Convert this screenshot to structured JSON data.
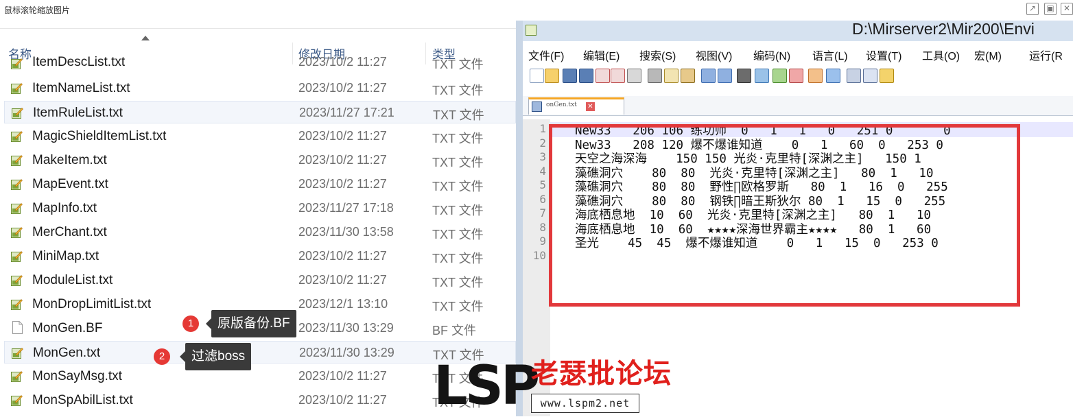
{
  "page_title": "鼠标滚轮缩放图片",
  "window_controls": [
    "expand-icon",
    "maximize-icon",
    "close-icon"
  ],
  "explorer": {
    "columns": {
      "name": "名称",
      "date": "修改日期",
      "type": "类型"
    },
    "partial_row": {
      "name": "ItemDescList.txt",
      "date": "2023/10/2 11:27",
      "type": "TXT 文件"
    },
    "files": [
      {
        "name": "ItemNameList.txt",
        "date": "2023/10/2 11:27",
        "type": "TXT 文件",
        "icon": "notepadpp-file-icon"
      },
      {
        "name": "ItemRuleList.txt",
        "date": "2023/11/27 17:21",
        "type": "TXT 文件",
        "icon": "notepadpp-file-icon",
        "selected": true
      },
      {
        "name": "MagicShieldItemList.txt",
        "date": "2023/10/2 11:27",
        "type": "TXT 文件",
        "icon": "notepadpp-file-icon"
      },
      {
        "name": "MakeItem.txt",
        "date": "2023/10/2 11:27",
        "type": "TXT 文件",
        "icon": "notepadpp-file-icon"
      },
      {
        "name": "MapEvent.txt",
        "date": "2023/10/2 11:27",
        "type": "TXT 文件",
        "icon": "notepadpp-file-icon"
      },
      {
        "name": "MapInfo.txt",
        "date": "2023/11/27 17:18",
        "type": "TXT 文件",
        "icon": "notepadpp-file-icon"
      },
      {
        "name": "MerChant.txt",
        "date": "2023/11/30 13:58",
        "type": "TXT 文件",
        "icon": "notepadpp-file-icon"
      },
      {
        "name": "MiniMap.txt",
        "date": "2023/10/2 11:27",
        "type": "TXT 文件",
        "icon": "notepadpp-file-icon"
      },
      {
        "name": "ModuleList.txt",
        "date": "2023/10/2 11:27",
        "type": "TXT 文件",
        "icon": "notepadpp-file-icon"
      },
      {
        "name": "MonDropLimitList.txt",
        "date": "2023/12/1 13:10",
        "type": "TXT 文件",
        "icon": "notepadpp-file-icon"
      },
      {
        "name": "MonGen.BF",
        "date": "2023/11/30 13:29",
        "type": "BF 文件",
        "icon": "blank-file-icon"
      },
      {
        "name": "MonGen.txt",
        "date": "2023/11/30 13:29",
        "type": "TXT 文件",
        "icon": "notepadpp-file-icon",
        "selected": true
      },
      {
        "name": "MonSayMsg.txt",
        "date": "2023/10/2 11:27",
        "type": "TXT 文件",
        "icon": "notepadpp-file-icon"
      },
      {
        "name": "MonSpAbilList.txt",
        "date": "2023/10/2 11:27",
        "type": "TXT 文件",
        "icon": "notepadpp-file-icon"
      }
    ]
  },
  "callouts": [
    {
      "number": "1",
      "text": "原版备份.BF"
    },
    {
      "number": "2",
      "text": "过滤boss"
    }
  ],
  "watermark": {
    "logo": "LSP",
    "site_name": "老瑟批论坛",
    "url": "www.lspm2.net"
  },
  "notepad": {
    "title_path": "D:\\Mirserver2\\Mir200\\Envi",
    "menu": [
      "文件(F)",
      "编辑(E)",
      "搜索(S)",
      "视图(V)",
      "编码(N)",
      "语言(L)",
      "设置(T)",
      "工具(O)",
      "宏(M)",
      "运行(R"
    ],
    "tab_name": "onGen.txt",
    "lines": [
      "New33   206 106 练功师  0   1   1   0   251 0       0",
      "New33   208 120 爆不爆谁知道    0   1   60  0   253 0",
      "天空之海深海    150 150 光炎·克里特[深渊之主]   150 1",
      "藻礁洞穴    80  80  光炎·克里特[深渊之主]   80  1   10",
      "藻礁洞穴    80  80  野性∏欧格罗斯   80  1   16  0   255",
      "藻礁洞穴    80  80  钢铁∏暗王斯狄尔 80  1   15  0   255",
      "海底栖息地  10  60  光炎·克里特[深渊之主]   80  1   10",
      "海底栖息地  10  60  ★★★★深海世界霸主★★★★   80  1   60",
      "圣光    45  45  爆不爆谁知道    0   1   15  0   253 0",
      ""
    ],
    "line_numbers": [
      "1",
      "2",
      "3",
      "4",
      "5",
      "6",
      "7",
      "8",
      "9",
      "10"
    ]
  },
  "colors": {
    "highlight_box": "#e2383b",
    "callout_badge": "#e53935",
    "callout_bg": "#3a3a3a",
    "header_text": "#3c5a87"
  }
}
